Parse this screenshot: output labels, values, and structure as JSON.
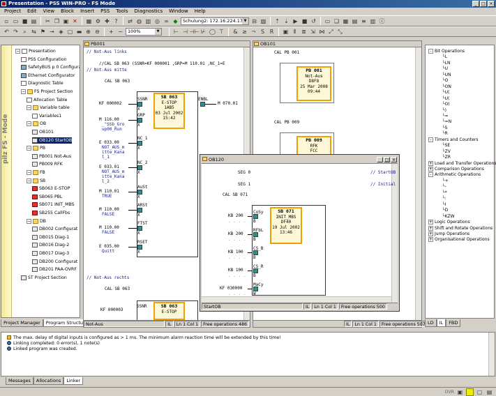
{
  "app": {
    "title": "Presentation - PSS WIN-PRO - FS Mode"
  },
  "menu": [
    "Project",
    "Edit",
    "View",
    "Block",
    "Insert",
    "PSS",
    "Tools",
    "Diagnostics",
    "Window",
    "Help"
  ],
  "toolbar": {
    "connection": "Schulung2: 172.16.224.17",
    "zoom": "100%"
  },
  "tree": {
    "mode_label": "pilz FS - Mode",
    "items": [
      {
        "label": "Presentation",
        "x": 4,
        "icon": "doc"
      },
      {
        "label": "PSS Configuration",
        "x": 12,
        "icon": "doc"
      },
      {
        "label": "SafetyBUS p 0 Configuration",
        "x": 12,
        "icon": "net"
      },
      {
        "label": "Ethernet Configurator",
        "x": 12,
        "icon": "net"
      },
      {
        "label": "Diagnostic Table",
        "x": 12,
        "icon": "doc"
      },
      {
        "label": "FS Project Section",
        "x": 12,
        "icon": "fold"
      },
      {
        "label": "Allocation Table",
        "x": 20,
        "icon": "doc"
      },
      {
        "label": "Variable table",
        "x": 20,
        "icon": "fold"
      },
      {
        "label": "Variables1",
        "x": 28,
        "icon": "doc"
      },
      {
        "label": "OB",
        "x": 20,
        "icon": "fold"
      },
      {
        "label": "OB101",
        "x": 28,
        "icon": "blk"
      },
      {
        "label": "OB120 StartOB",
        "x": 28,
        "icon": "blk",
        "selected": true
      },
      {
        "label": "PB",
        "x": 20,
        "icon": "fold"
      },
      {
        "label": "PB001 Not-Aus",
        "x": 28,
        "icon": "blk"
      },
      {
        "label": "PB009 RFK",
        "x": 28,
        "icon": "blk"
      },
      {
        "label": "FB",
        "x": 20,
        "icon": "fold"
      },
      {
        "label": "SB",
        "x": 20,
        "icon": "fold"
      },
      {
        "label": "SB063 E-STOP",
        "x": 28,
        "icon": "red"
      },
      {
        "label": "SB065 PBL",
        "x": 28,
        "icon": "red"
      },
      {
        "label": "SB071 INIT_MBS",
        "x": 28,
        "icon": "red"
      },
      {
        "label": "SB255 CallFbs",
        "x": 28,
        "icon": "red"
      },
      {
        "label": "DB",
        "x": 20,
        "icon": "fold"
      },
      {
        "label": "DB002 Configurat",
        "x": 28,
        "icon": "blk"
      },
      {
        "label": "DB015 Diag-1",
        "x": 28,
        "icon": "blk"
      },
      {
        "label": "DB016 Diag-2",
        "x": 28,
        "icon": "blk"
      },
      {
        "label": "DB017 Diag-3",
        "x": 28,
        "icon": "blk"
      },
      {
        "label": "DB200 Configurat",
        "x": 28,
        "icon": "blk"
      },
      {
        "label": "DB201 PAA-OVRF",
        "x": 28,
        "icon": "blk"
      },
      {
        "label": "ST Project Section",
        "x": 12,
        "icon": "blk"
      }
    ],
    "tabs": [
      "Project Manager",
      "Program Structure"
    ]
  },
  "win_pb": {
    "title": "PB001",
    "comment1": "// Not-Aus links",
    "call_line": "//CAL  SB 063 (SSNR=KF 000001 ,GRP=M  110.01 ,NC_1=E",
    "comment2": "// Not-Aus mitte",
    "cal": "CAL  SB 063",
    "comment3": "// Not-Aus rechts",
    "cal2": "CAL  SB 063",
    "block": {
      "name": "SB 063",
      "type": "E-STOP",
      "id": "1AB5",
      "date": "03 Jul 2002",
      "time": "15:42"
    },
    "inputs": [
      {
        "op": "KF 000002",
        "pin": "SSNR",
        "sub": ""
      },
      {
        "op": "M  116.00",
        "pin": "GRP",
        "sub": "_\"SSb_Gro\nup00_Run"
      },
      {
        "op": "E  033.00",
        "pin": "NC_1",
        "sub": "NOT_AUS_m\nitte_Kana\nl_1"
      },
      {
        "op": "E  033.01",
        "pin": "NC_2",
        "sub": "NOT_AUS_m\nitte_Kana\nl_2"
      },
      {
        "op": "M  110.01",
        "pin": "AuSt",
        "sub": "TRUE"
      },
      {
        "op": "M  110.00",
        "pin": "ARSt",
        "sub": "FALSE"
      },
      {
        "op": "M  110.00",
        "pin": "FTST",
        "sub": "FALSE"
      },
      {
        "op": "E  035.00",
        "pin": "RSET",
        "sub": "Quitt"
      }
    ],
    "output": {
      "pin": "ENBL",
      "op": "M  070.01"
    },
    "second": {
      "op": "KF 000003",
      "pin": "SSNR",
      "name": "SB 063",
      "type": "E-STOP"
    },
    "status": [
      "Not-Aus",
      "IL",
      "Ln 1 Col 1",
      "Free operations 486"
    ]
  },
  "win_ob101": {
    "title": "OB101",
    "cal1": "CAL  PB 001",
    "cal2": "CAL  PB 009",
    "pb1": {
      "name": "PB 001",
      "type": "Not-Aus",
      "id": "D8F8",
      "date": "25 Mar 2008",
      "time": "09:44"
    },
    "pb2": {
      "name": "PB 009",
      "type": "RFK",
      "id": "FCC"
    },
    "status": [
      "IL",
      "Ln 1 Col 1",
      "Free operations 507"
    ]
  },
  "win_ob120": {
    "title": "OB120",
    "seg0": "SEG 0",
    "seg0c": "// StartOB",
    "seg1": "SEG 1",
    "seg1c": "// Initial",
    "cal": "CAL  SB 071",
    "block": {
      "name": "SB 071",
      "type": "INIT_MBS",
      "id": "DF40",
      "date": "19 Jul 2002",
      "time": "13:46"
    },
    "inputs": [
      {
        "op": "KB 200",
        "pin": "CoSy"
      },
      {
        "op": "KB 200",
        "pin": "RFbL"
      },
      {
        "op": "KB 100",
        "pin": "CS_B"
      },
      {
        "op": "KB 100",
        "pin": "CS_R"
      },
      {
        "op": "KF 030000",
        "pin": "MaCy"
      }
    ],
    "status": [
      "StartOB",
      "IL",
      "Ln 1 Col 1",
      "Free operations 500"
    ]
  },
  "right_tree": {
    "items": [
      {
        "label": "Bit Operations",
        "x": 2,
        "exp": "-"
      },
      {
        "label": "L",
        "x": 22
      },
      {
        "label": "LN",
        "x": 22
      },
      {
        "label": "U",
        "x": 22
      },
      {
        "label": "UN",
        "x": 22
      },
      {
        "label": "O",
        "x": 22
      },
      {
        "label": "ON",
        "x": 22
      },
      {
        "label": "U(",
        "x": 22
      },
      {
        "label": "U(",
        "x": 22
      },
      {
        "label": "O(",
        "x": 22
      },
      {
        "label": ")",
        "x": 22
      },
      {
        "label": "=",
        "x": 22
      },
      {
        "label": "=N",
        "x": 22
      },
      {
        "label": "S",
        "x": 22
      },
      {
        "label": "R",
        "x": 22
      },
      {
        "label": "Timers and Counters",
        "x": 2,
        "exp": "-"
      },
      {
        "label": "SE",
        "x": 22
      },
      {
        "label": "ZV",
        "x": 22
      },
      {
        "label": "ZR",
        "x": 22
      },
      {
        "label": "Load and Transfer Operations",
        "x": 2,
        "exp": "+"
      },
      {
        "label": "Comparison Operations",
        "x": 2,
        "exp": "+"
      },
      {
        "label": "Arithmetic Operations",
        "x": 2,
        "exp": "-"
      },
      {
        "label": "+",
        "x": 22
      },
      {
        "label": "-",
        "x": 22
      },
      {
        "label": "*",
        "x": 22
      },
      {
        "label": ":",
        "x": 22
      },
      {
        "label": "I",
        "x": 22
      },
      {
        "label": "D",
        "x": 22
      },
      {
        "label": "KZW",
        "x": 22
      },
      {
        "label": "Logic Operations",
        "x": 2,
        "exp": "+"
      },
      {
        "label": "Shift and Rotate Operations",
        "x": 2,
        "exp": "+"
      },
      {
        "label": "Jump Operations",
        "x": 2,
        "exp": "+"
      },
      {
        "label": "Organisational Operations",
        "x": 2,
        "exp": "+"
      }
    ],
    "tabs": [
      "LD",
      "IL",
      "FBD"
    ]
  },
  "messages": {
    "lines": [
      {
        "text": "The max. delay of digital inputs is configured as > 1 ms. The minimum alarm reaction time will be extended by this time!",
        "icon": "warn"
      },
      {
        "text": "Linking completed: 0 error(s), 1 note(s)",
        "icon": "info"
      },
      {
        "text": "Linked program was created.",
        "icon": "info"
      }
    ],
    "tabs": [
      "Messages",
      "Allocations",
      "Linker"
    ]
  },
  "statusbar": {
    "ovr": "OVR"
  }
}
